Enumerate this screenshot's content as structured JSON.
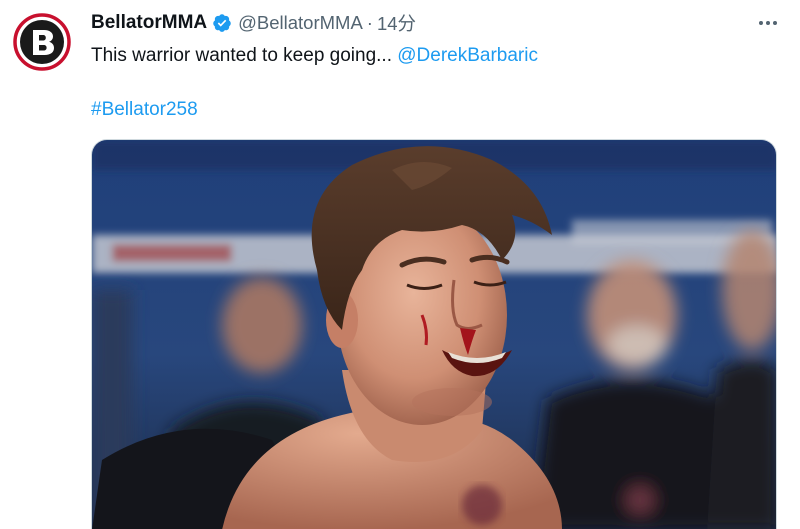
{
  "tweet": {
    "avatar_icon": "bellator-logo-icon",
    "display_name": "BellatorMMA",
    "verified_icon": "verified-badge-icon",
    "handle": "@BellatorMMA",
    "separator": "·",
    "time": "14分",
    "more_icon": "more-options-icon",
    "text_prefix": "This warrior wanted to keep going... ",
    "mention": "@DerekBarbaric",
    "hashtag": "#Bellator258",
    "image_icon": "fighter-photo",
    "colors": {
      "link": "#1d9bf0",
      "verified": "#1d9bf0",
      "logo_red": "#c8102e",
      "text": "#0f1419",
      "secondary": "#536471"
    }
  }
}
